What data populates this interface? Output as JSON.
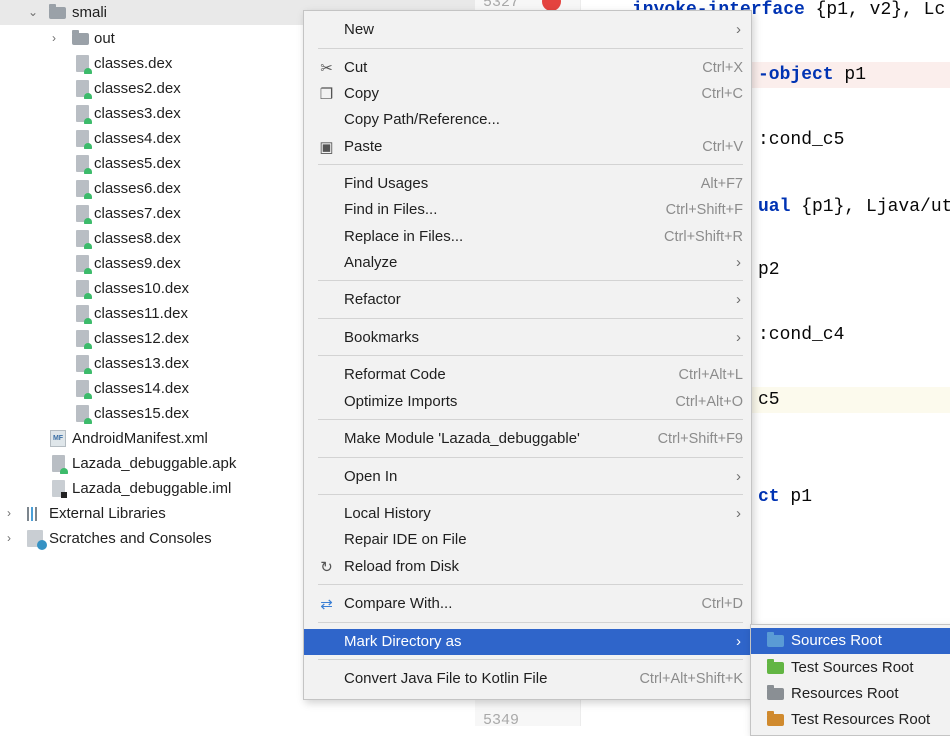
{
  "project_tree": {
    "root_folder": "smali",
    "out_folder": "out",
    "dex_files": [
      "classes.dex",
      "classes2.dex",
      "classes3.dex",
      "classes4.dex",
      "classes5.dex",
      "classes6.dex",
      "classes7.dex",
      "classes8.dex",
      "classes9.dex",
      "classes10.dex",
      "classes11.dex",
      "classes12.dex",
      "classes13.dex",
      "classes14.dex",
      "classes15.dex"
    ],
    "manifest": "AndroidManifest.xml",
    "manifest_badge": "MF",
    "apk": "Lazada_debuggable.apk",
    "iml": "Lazada_debuggable.iml",
    "external_libraries": "External Libraries",
    "scratches": "Scratches and Consoles"
  },
  "editor": {
    "top_line_number": "5327",
    "bottom_line_number": "5349",
    "lines": [
      {
        "pre": "",
        "kw": "invoke-interface",
        "post": " {p1, v2}, Lc"
      },
      {
        "pre": "",
        "kw": "-object",
        "post": " p1"
      },
      {
        "pre": ":cond_c5",
        "kw": "",
        "post": ""
      },
      {
        "pre": "",
        "kw": "ual",
        "post": " {p1}, Ljava/ut"
      },
      {
        "pre": " p2",
        "kw": "",
        "post": ""
      },
      {
        "pre": ":cond_c4",
        "kw": "",
        "post": ""
      },
      {
        "pre": "c5",
        "kw": "",
        "post": ""
      },
      {
        "pre": "",
        "kw": "ct",
        "post": " p1"
      }
    ]
  },
  "context_menu": {
    "items": [
      {
        "label": "New",
        "shortcut": "",
        "submenu": true,
        "icon": ""
      },
      {
        "label": "Cut",
        "shortcut": "Ctrl+X",
        "submenu": false,
        "icon": "scissors-icon"
      },
      {
        "label": "Copy",
        "shortcut": "Ctrl+C",
        "submenu": false,
        "icon": "copy-icon"
      },
      {
        "label": "Copy Path/Reference...",
        "shortcut": "",
        "submenu": false,
        "icon": ""
      },
      {
        "label": "Paste",
        "shortcut": "Ctrl+V",
        "submenu": false,
        "icon": "clipboard-icon"
      },
      {
        "label": "Find Usages",
        "shortcut": "Alt+F7",
        "submenu": false,
        "icon": ""
      },
      {
        "label": "Find in Files...",
        "shortcut": "Ctrl+Shift+F",
        "submenu": false,
        "icon": ""
      },
      {
        "label": "Replace in Files...",
        "shortcut": "Ctrl+Shift+R",
        "submenu": false,
        "icon": ""
      },
      {
        "label": "Analyze",
        "shortcut": "",
        "submenu": true,
        "icon": ""
      },
      {
        "label": "Refactor",
        "shortcut": "",
        "submenu": true,
        "icon": ""
      },
      {
        "label": "Bookmarks",
        "shortcut": "",
        "submenu": true,
        "icon": ""
      },
      {
        "label": "Reformat Code",
        "shortcut": "Ctrl+Alt+L",
        "submenu": false,
        "icon": ""
      },
      {
        "label": "Optimize Imports",
        "shortcut": "Ctrl+Alt+O",
        "submenu": false,
        "icon": ""
      },
      {
        "label": "Make Module 'Lazada_debuggable'",
        "shortcut": "Ctrl+Shift+F9",
        "submenu": false,
        "icon": ""
      },
      {
        "label": "Open In",
        "shortcut": "",
        "submenu": true,
        "icon": ""
      },
      {
        "label": "Local History",
        "shortcut": "",
        "submenu": true,
        "icon": ""
      },
      {
        "label": "Repair IDE on File",
        "shortcut": "",
        "submenu": false,
        "icon": ""
      },
      {
        "label": "Reload from Disk",
        "shortcut": "",
        "submenu": false,
        "icon": "reload-icon"
      },
      {
        "label": "Compare With...",
        "shortcut": "Ctrl+D",
        "submenu": false,
        "icon": "compare-icon"
      },
      {
        "label": "Mark Directory as",
        "shortcut": "",
        "submenu": true,
        "icon": "",
        "active": true
      },
      {
        "label": "Convert Java File to Kotlin File",
        "shortcut": "Ctrl+Alt+Shift+K",
        "submenu": false,
        "icon": ""
      }
    ]
  },
  "submenu": {
    "items": [
      {
        "label": "Sources Root",
        "color": "#5a9bd5",
        "active": true
      },
      {
        "label": "Test Sources Root",
        "color": "#62b543"
      },
      {
        "label": "Resources Root",
        "color": "#8a8f94"
      },
      {
        "label": "Test Resources Root",
        "color": "#d08a2e"
      }
    ]
  },
  "colors": {
    "menu_highlight": "#2f65ca",
    "keyword": "#0033b3",
    "breakpoint": "#e4433f"
  }
}
